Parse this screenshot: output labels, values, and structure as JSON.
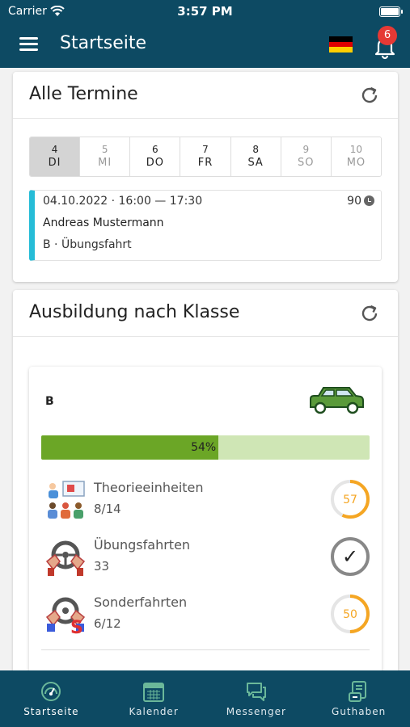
{
  "status_bar": {
    "carrier": "Carrier",
    "time": "3:57 PM"
  },
  "app_bar": {
    "title": "Startseite",
    "notification_count": "6",
    "language_flag": "de"
  },
  "appointments": {
    "title": "Alle Termine",
    "days": [
      {
        "num": "4",
        "abbr": "DI",
        "state": "active"
      },
      {
        "num": "5",
        "abbr": "MI",
        "state": "muted"
      },
      {
        "num": "6",
        "abbr": "DO",
        "state": "normal"
      },
      {
        "num": "7",
        "abbr": "FR",
        "state": "normal"
      },
      {
        "num": "8",
        "abbr": "SA",
        "state": "normal"
      },
      {
        "num": "9",
        "abbr": "SO",
        "state": "muted"
      },
      {
        "num": "10",
        "abbr": "MO",
        "state": "muted"
      }
    ],
    "item": {
      "datetime": "04.10.2022 · 16:00 — 17:30",
      "duration": "90",
      "name": "Andreas Mustermann",
      "type": "B · Übungsfahrt",
      "accent_color": "#26bcd7"
    }
  },
  "training": {
    "title": "Ausbildung nach Klasse",
    "class_label": "B",
    "progress_percent": 54,
    "progress_label": "54%",
    "rows": [
      {
        "label": "Theorieeinheiten",
        "value": "8/14",
        "ring_text": "57",
        "ring_fraction": 0.57,
        "icon": "classroom-icon"
      },
      {
        "label": "Übungsfahrten",
        "value": "33",
        "ring_text": "✓",
        "ring_fraction": 1.0,
        "icon": "steering-wheel-icon"
      },
      {
        "label": "Sonderfahrten",
        "value": "6/12",
        "ring_text": "50",
        "ring_fraction": 0.5,
        "icon": "special-drive-icon"
      }
    ]
  },
  "bottom_nav": [
    {
      "label": "Startseite",
      "icon": "dashboard-icon"
    },
    {
      "label": "Kalender",
      "icon": "calendar-icon"
    },
    {
      "label": "Messenger",
      "icon": "chat-icon"
    },
    {
      "label": "Guthaben",
      "icon": "wallet-icon"
    }
  ],
  "colors": {
    "primary": "#0d4a63",
    "progress_fill": "#6ba626",
    "progress_track": "#cfe6b5",
    "ring_orange": "#f5a623",
    "badge_red": "#e53935"
  }
}
